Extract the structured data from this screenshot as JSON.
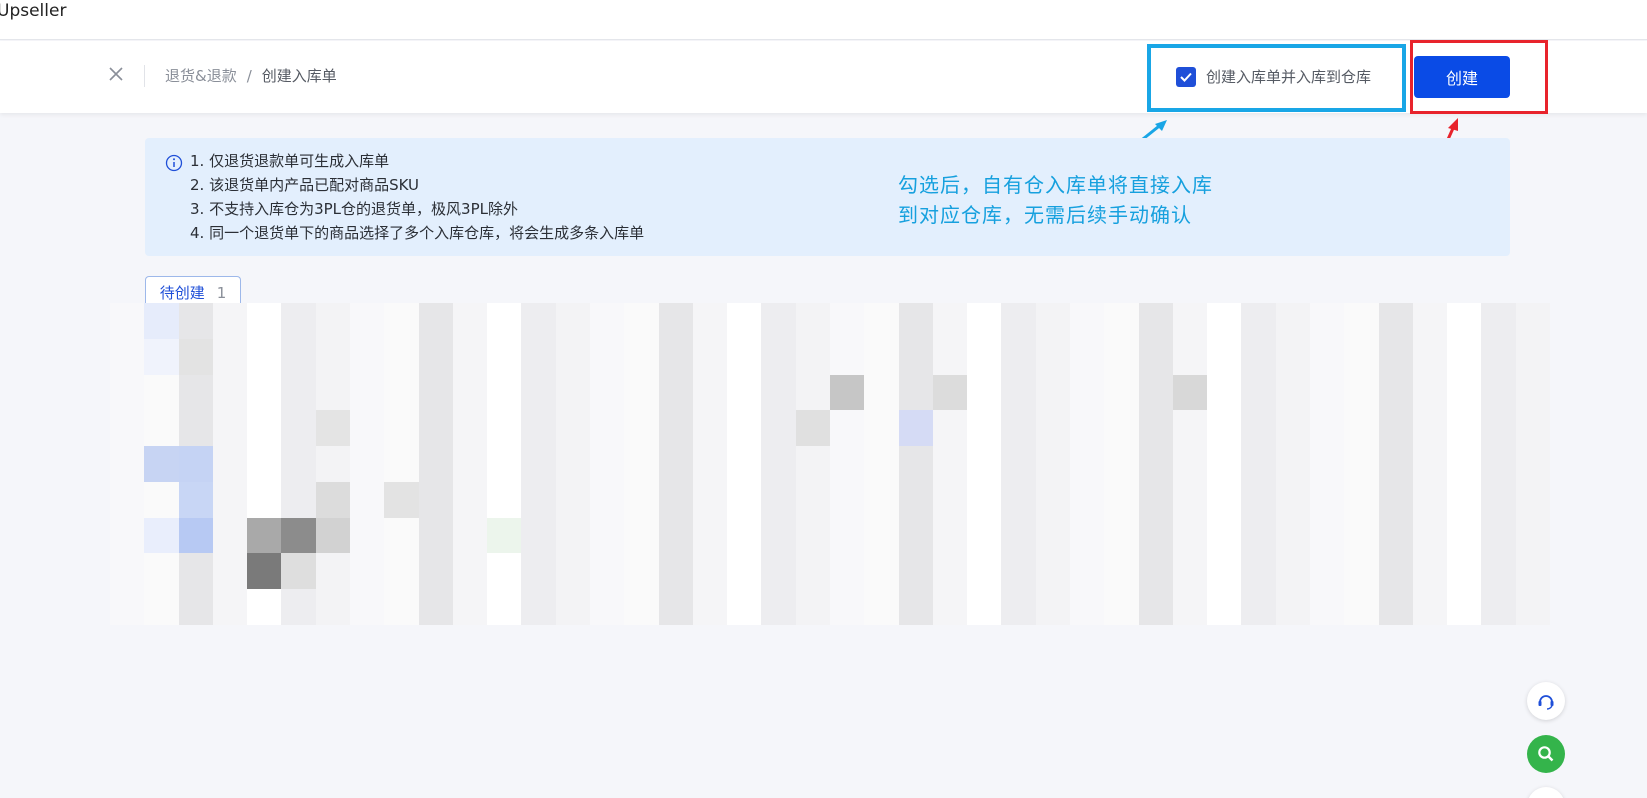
{
  "app": {
    "title": "Upseller"
  },
  "header": {
    "breadcrumb": {
      "parent": "退货&退款",
      "separator": "/",
      "current": "创建入库单"
    },
    "checkbox_label": "创建入库单并入库到仓库",
    "checkbox_checked": true,
    "create_button": "创建"
  },
  "info": {
    "lines": [
      "1. 仅退货退款单可生成入库单",
      "2. 该退货单内产品已配对商品SKU",
      "3. 不支持入库仓为3PL仓的退货单，极风3PL除外",
      "4. 同一个退货单下的商品选择了多个入库仓库，将会生成多条入库单"
    ]
  },
  "annotation": {
    "line1": "勾选后，自有仓入库单将直接入库",
    "line2": "到对应仓库，无需后续手动确认"
  },
  "tabs": [
    {
      "label": "待创建",
      "count": "1"
    }
  ],
  "colors": {
    "primary": "#0a4be6",
    "annotation_blue": "#19a6e6",
    "annotation_red": "#e8232c",
    "info_bg": "#e3effd"
  },
  "icons": {
    "close": "close-icon",
    "info": "info-icon",
    "check": "check-icon",
    "support": "headset-icon",
    "search": "search-icon"
  }
}
